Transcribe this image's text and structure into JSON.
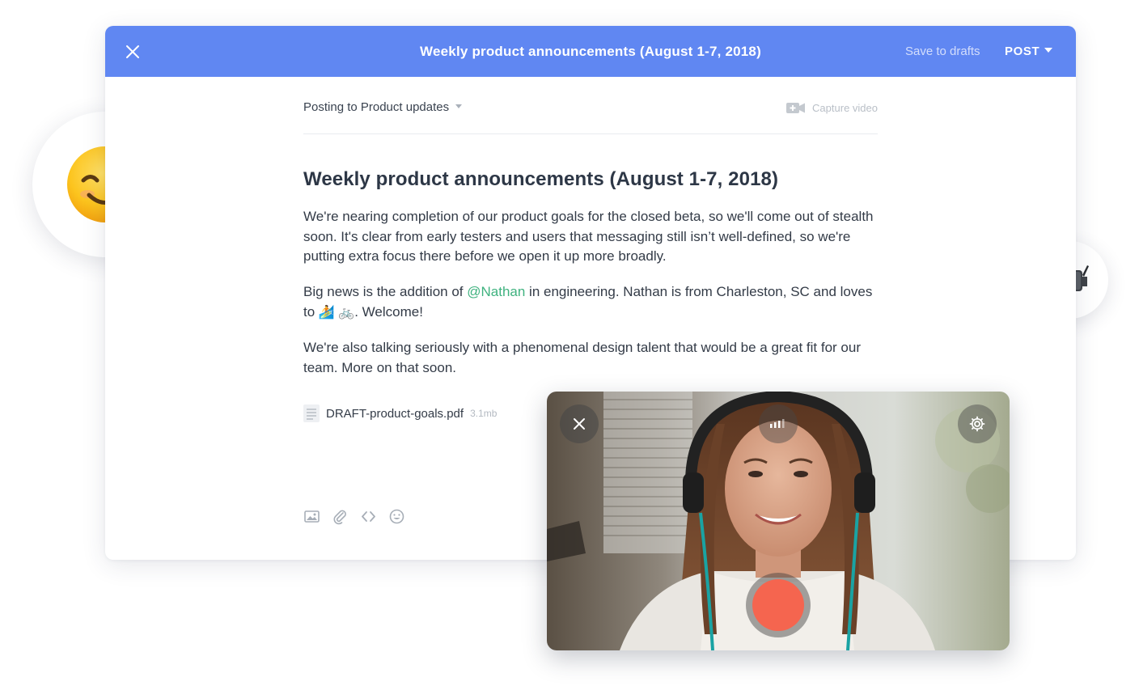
{
  "header": {
    "title": "Weekly product announcements (August 1-7, 2018)",
    "save_drafts": "Save to drafts",
    "post": "POST"
  },
  "composer": {
    "posting_to": "Posting to Product updates",
    "capture_video": "Capture video"
  },
  "post": {
    "title": "Weekly product announcements (August 1-7, 2018)",
    "p1": "We're nearing completion of our product goals for the closed beta, so we'll come out of stealth soon. It's clear from early testers and users that messaging still isn’t well-defined, so we're putting extra focus there before we open it up more broadly.",
    "p2_before": "Big news is the addition of ",
    "p2_mention": "@Nathan",
    "p2_after": " in engineering. Nathan is from Charleston, SC and loves to ",
    "p2_emoji": "🏄 🚲",
    "p2_end": ". Welcome!",
    "p3": "We're also talking seriously with a phenomenal design talent that would be a great fit for our team. More on that soon."
  },
  "attachment": {
    "filename": "DRAFT-product-goals.pdf",
    "size": "3.1mb"
  },
  "toolbar": {
    "icons": [
      "image-icon",
      "paperclip-icon",
      "code-icon",
      "emoji-icon"
    ]
  },
  "floating": {
    "emoji": "😊",
    "camera_icon": "video-camera-icon"
  },
  "video": {
    "buttons": [
      "close-icon",
      "audio-level-icon",
      "settings-gear-icon",
      "record-button"
    ],
    "record_color": "#f5654f"
  },
  "colors": {
    "header_bg": "#6087f2",
    "mention": "#3fb27f"
  }
}
